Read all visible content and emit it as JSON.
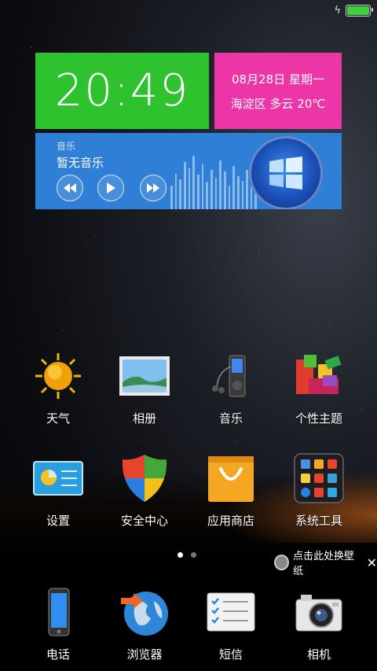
{
  "status": {
    "battery_level": 1.0,
    "battery_color": "#3bd23b"
  },
  "widgets": {
    "clock": {
      "time": "20:49"
    },
    "weather": {
      "date_line": "08月28日  星期一",
      "weather_line": "海淀区  多云  20℃"
    },
    "music": {
      "section_label": "音乐",
      "track_title": "暂无音乐"
    }
  },
  "apps_row1": [
    {
      "label": "天气",
      "icon": "weather-sun-icon"
    },
    {
      "label": "相册",
      "icon": "photo-album-icon"
    },
    {
      "label": "音乐",
      "icon": "music-player-icon"
    },
    {
      "label": "个性主题",
      "icon": "theme-blocks-icon"
    }
  ],
  "apps_row2": [
    {
      "label": "设置",
      "icon": "settings-panel-icon"
    },
    {
      "label": "安全中心",
      "icon": "security-shield-icon"
    },
    {
      "label": "应用商店",
      "icon": "shopping-bag-icon"
    },
    {
      "label": "系统工具",
      "icon": "tools-folder-icon"
    }
  ],
  "page_indicator": {
    "pages": 2,
    "current": 1
  },
  "wallpaper_hint": {
    "text": "点击此处换壁纸",
    "close": "✕"
  },
  "dock": [
    {
      "label": "电话",
      "icon": "phone-icon"
    },
    {
      "label": "浏览器",
      "icon": "browser-globe-icon"
    },
    {
      "label": "短信",
      "icon": "messages-icon"
    },
    {
      "label": "相机",
      "icon": "camera-icon"
    }
  ],
  "colors": {
    "clock_bg": "#2fc22f",
    "weather_bg": "#ec35a7",
    "music_bg": "#2f7fd6"
  }
}
